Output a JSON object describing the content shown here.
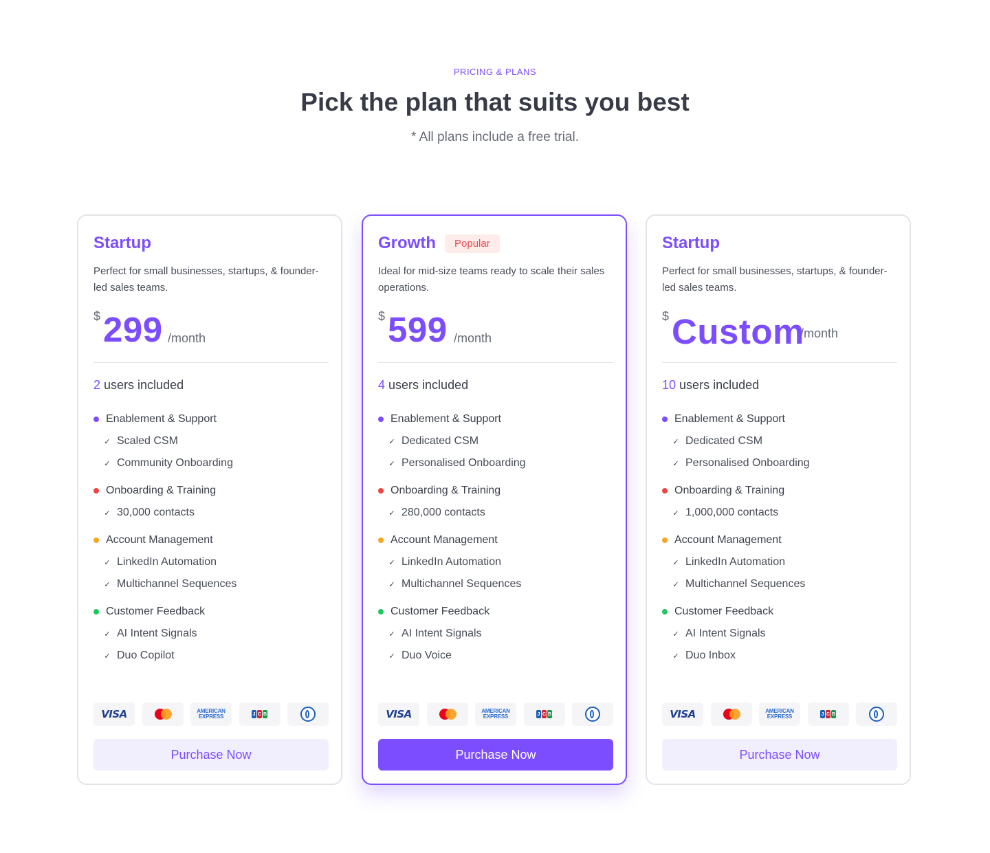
{
  "header": {
    "eyebrow": "PRICING & PLANS",
    "title": "Pick the plan that suits you best",
    "subtitle": "* All plans include a free trial."
  },
  "colors": {
    "accent": "#7c4dff",
    "dot_blue": "#7c4dff",
    "dot_red": "#ef4444",
    "dot_orange": "#f5a623",
    "dot_green": "#22c55e"
  },
  "payment_icons": [
    "visa-icon",
    "mastercard-icon",
    "amex-icon",
    "jcb-icon",
    "diners-icon"
  ],
  "payment_text": {
    "visa": "VISA",
    "amex_line1": "AMERICAN",
    "amex_line2": "EXPRESS",
    "jcb_j": "J",
    "jcb_c": "C",
    "jcb_b": "B"
  },
  "plans": [
    {
      "name": "Startup",
      "badge": "",
      "description": "Perfect for small businesses, startups, & founder-led sales teams.",
      "currency": "$",
      "price": "299",
      "period": "/month",
      "users_count": "2",
      "users_label": "users included",
      "groups": [
        {
          "title": "Enablement & Support",
          "features": [
            "Scaled CSM",
            "Community Onboarding"
          ]
        },
        {
          "title": "Onboarding & Training",
          "features": [
            "30,000 contacts"
          ]
        },
        {
          "title": "Account Management",
          "features": [
            "LinkedIn Automation",
            "Multichannel Sequences"
          ]
        },
        {
          "title": "Customer Feedback",
          "features": [
            "AI Intent Signals",
            "Duo Copilot"
          ]
        }
      ],
      "cta": "Purchase Now"
    },
    {
      "name": "Growth",
      "badge": "Popular",
      "description": "Ideal for mid-size teams ready to scale their sales operations.",
      "currency": "$",
      "price": "599",
      "period": "/month",
      "users_count": "4",
      "users_label": "users included",
      "groups": [
        {
          "title": "Enablement & Support",
          "features": [
            "Dedicated CSM",
            "Personalised Onboarding"
          ]
        },
        {
          "title": "Onboarding & Training",
          "features": [
            "280,000 contacts"
          ]
        },
        {
          "title": "Account Management",
          "features": [
            "LinkedIn Automation",
            "Multichannel Sequences"
          ]
        },
        {
          "title": "Customer Feedback",
          "features": [
            "AI Intent Signals",
            "Duo Voice"
          ]
        }
      ],
      "cta": "Purchase Now"
    },
    {
      "name": "Startup",
      "badge": "",
      "description": "Perfect for small businesses, startups, & founder-led sales teams.",
      "currency": "$",
      "price": "Custom",
      "period": "/month",
      "users_count": "10",
      "users_label": "users included",
      "groups": [
        {
          "title": "Enablement & Support",
          "features": [
            "Dedicated CSM",
            "Personalised Onboarding"
          ]
        },
        {
          "title": "Onboarding & Training",
          "features": [
            "1,000,000 contacts"
          ]
        },
        {
          "title": "Account Management",
          "features": [
            "LinkedIn Automation",
            "Multichannel Sequences"
          ]
        },
        {
          "title": "Customer Feedback",
          "features": [
            "AI Intent Signals",
            "Duo Inbox"
          ]
        }
      ],
      "cta": "Purchase Now"
    }
  ]
}
